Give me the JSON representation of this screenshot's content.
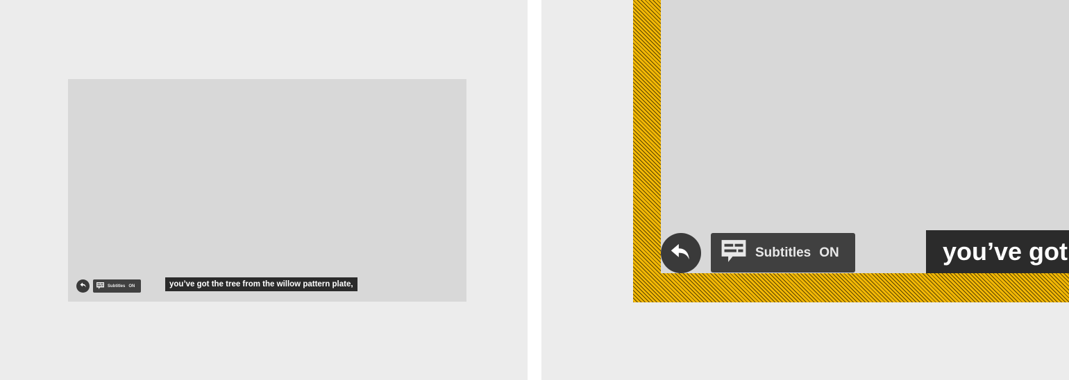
{
  "colors": {
    "page_background": "#ececec",
    "video_area": "#d8d8d8",
    "control_background": "#3a3a3a",
    "caption_background": "#2b2b2b",
    "highlight_hatch": "#f2b705"
  },
  "player": {
    "back_button": {
      "icon": "back-arrow-icon"
    },
    "subtitles_toggle": {
      "icon": "subtitles-icon",
      "label": "Subtitles",
      "state": "ON"
    },
    "caption_text": "you’ve got the tree from the willow pattern plate,"
  },
  "zoom_view": {
    "back_button": {
      "icon": "back-arrow-icon"
    },
    "subtitles_toggle": {
      "icon": "subtitles-icon",
      "label": "Subtitles",
      "state": "ON"
    },
    "caption_text": "you’ve got"
  }
}
